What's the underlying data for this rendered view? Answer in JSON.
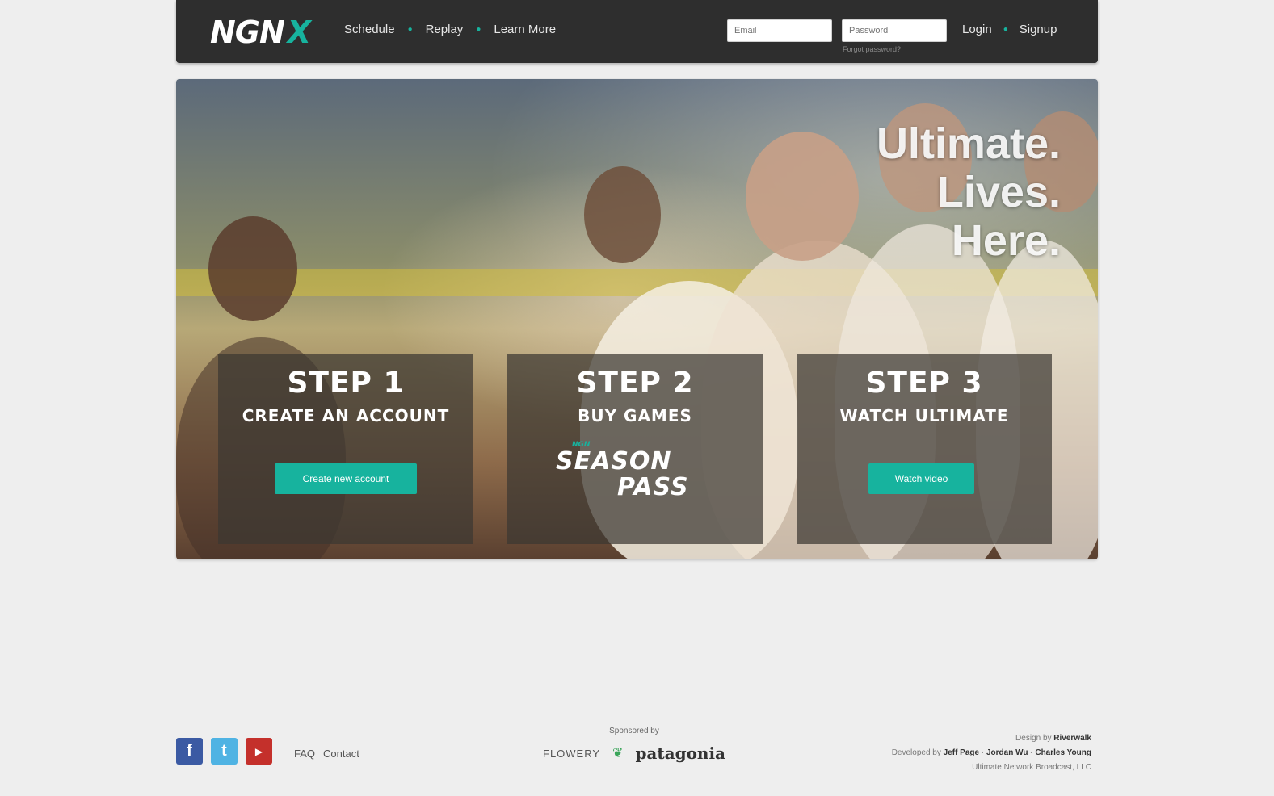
{
  "header": {
    "logo_main": "NGN",
    "logo_accent": "X",
    "nav": [
      "Schedule",
      "Replay",
      "Learn More"
    ],
    "login": {
      "email_placeholder": "Email",
      "password_placeholder": "Password",
      "forgot": "Forgot password?"
    },
    "auth": {
      "login": "Login",
      "signup": "Signup"
    }
  },
  "hero": {
    "tagline": [
      "Ultimate.",
      "Lives.",
      "Here."
    ],
    "steps": [
      {
        "title": "STEP 1",
        "subtitle": "CREATE AN ACCOUNT",
        "button": "Create new account"
      },
      {
        "title": "STEP 2",
        "subtitle": "BUY GAMES",
        "pass_top": "NGN",
        "pass_line1": "SEASON",
        "pass_line2": "PASS"
      },
      {
        "title": "STEP 3",
        "subtitle": "WATCH ULTIMATE",
        "button": "Watch video"
      }
    ]
  },
  "footer": {
    "social": [
      "facebook-icon",
      "twitter-icon",
      "youtube-icon"
    ],
    "links": [
      "FAQ",
      "Contact"
    ],
    "sponsors_label": "Sponsored by",
    "sponsor1": "FLOWERY",
    "sponsor2": "patagonia",
    "credits": [
      {
        "prefix": "Design by",
        "name": "Riverwalk"
      },
      {
        "prefix": "Developed by",
        "name": "Jeff Page · Jordan Wu · Charles Young"
      },
      {
        "prefix": "",
        "name": "Ultimate Network Broadcast, LLC"
      }
    ]
  },
  "colors": {
    "accent": "#17b39e",
    "header_bg": "#2e2e2e",
    "page_bg": "#eeeeee"
  }
}
